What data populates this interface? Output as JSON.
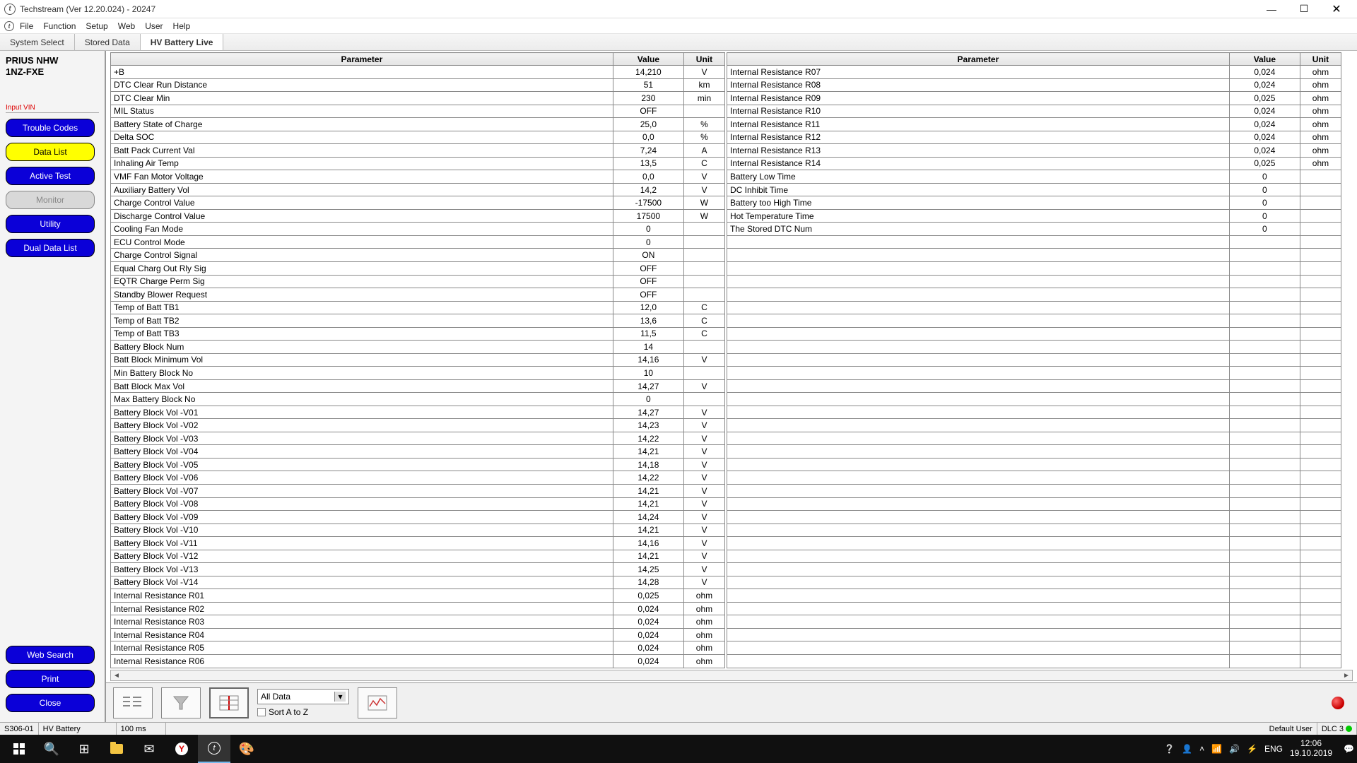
{
  "window": {
    "title": "Techstream (Ver 12.20.024) - 20247"
  },
  "menu": {
    "items": [
      "File",
      "Function",
      "Setup",
      "Web",
      "User",
      "Help"
    ]
  },
  "tabs": [
    {
      "label": "System Select",
      "active": false
    },
    {
      "label": "Stored Data",
      "active": false
    },
    {
      "label": "HV Battery Live",
      "active": true
    }
  ],
  "vehicle": {
    "line1": "PRIUS NHW",
    "line2": "1NZ-FXE",
    "input_vin": "Input VIN"
  },
  "side_buttons": [
    {
      "label": "Trouble Codes",
      "style": "blue"
    },
    {
      "label": "Data List",
      "style": "yellow"
    },
    {
      "label": "Active Test",
      "style": "blue"
    },
    {
      "label": "Monitor",
      "style": "grey"
    },
    {
      "label": "Utility",
      "style": "blue"
    },
    {
      "label": "Dual Data List",
      "style": "blue"
    }
  ],
  "side_bottom_buttons": [
    {
      "label": "Web Search",
      "style": "blue"
    },
    {
      "label": "Print",
      "style": "blue"
    },
    {
      "label": "Close",
      "style": "blue"
    }
  ],
  "table_headers": {
    "parameter": "Parameter",
    "value": "Value",
    "unit": "Unit"
  },
  "left_table": [
    {
      "p": "+B",
      "v": "14,210",
      "u": "V"
    },
    {
      "p": "DTC Clear Run Distance",
      "v": "51",
      "u": "km"
    },
    {
      "p": "DTC Clear Min",
      "v": "230",
      "u": "min"
    },
    {
      "p": "MIL Status",
      "v": "OFF",
      "u": ""
    },
    {
      "p": "Battery State of Charge",
      "v": "25,0",
      "u": "%"
    },
    {
      "p": "Delta SOC",
      "v": "0,0",
      "u": "%"
    },
    {
      "p": "Batt Pack Current Val",
      "v": "7,24",
      "u": "A"
    },
    {
      "p": "Inhaling Air Temp",
      "v": "13,5",
      "u": "C"
    },
    {
      "p": "VMF Fan Motor Voltage",
      "v": "0,0",
      "u": "V"
    },
    {
      "p": "Auxiliary Battery Vol",
      "v": "14,2",
      "u": "V"
    },
    {
      "p": "Charge Control Value",
      "v": "-17500",
      "u": "W"
    },
    {
      "p": "Discharge Control Value",
      "v": "17500",
      "u": "W"
    },
    {
      "p": "Cooling Fan Mode",
      "v": "0",
      "u": ""
    },
    {
      "p": "ECU Control Mode",
      "v": "0",
      "u": ""
    },
    {
      "p": "Charge Control Signal",
      "v": "ON",
      "u": ""
    },
    {
      "p": "Equal Charg Out Rly Sig",
      "v": "OFF",
      "u": ""
    },
    {
      "p": "EQTR Charge Perm Sig",
      "v": "OFF",
      "u": ""
    },
    {
      "p": "Standby Blower Request",
      "v": "OFF",
      "u": ""
    },
    {
      "p": "Temp of Batt TB1",
      "v": "12,0",
      "u": "C"
    },
    {
      "p": "Temp of Batt TB2",
      "v": "13,6",
      "u": "C"
    },
    {
      "p": "Temp of Batt TB3",
      "v": "11,5",
      "u": "C"
    },
    {
      "p": "Battery Block Num",
      "v": "14",
      "u": ""
    },
    {
      "p": "Batt Block Minimum Vol",
      "v": "14,16",
      "u": "V"
    },
    {
      "p": "Min Battery Block No",
      "v": "10",
      "u": ""
    },
    {
      "p": "Batt Block Max Vol",
      "v": "14,27",
      "u": "V"
    },
    {
      "p": "Max Battery Block No",
      "v": "0",
      "u": ""
    },
    {
      "p": "Battery Block Vol -V01",
      "v": "14,27",
      "u": "V"
    },
    {
      "p": "Battery Block Vol -V02",
      "v": "14,23",
      "u": "V"
    },
    {
      "p": "Battery Block Vol -V03",
      "v": "14,22",
      "u": "V"
    },
    {
      "p": "Battery Block Vol -V04",
      "v": "14,21",
      "u": "V"
    },
    {
      "p": "Battery Block Vol -V05",
      "v": "14,18",
      "u": "V"
    },
    {
      "p": "Battery Block Vol -V06",
      "v": "14,22",
      "u": "V"
    },
    {
      "p": "Battery Block Vol -V07",
      "v": "14,21",
      "u": "V"
    },
    {
      "p": "Battery Block Vol -V08",
      "v": "14,21",
      "u": "V"
    },
    {
      "p": "Battery Block Vol -V09",
      "v": "14,24",
      "u": "V"
    },
    {
      "p": "Battery Block Vol -V10",
      "v": "14,21",
      "u": "V"
    },
    {
      "p": "Battery Block Vol -V11",
      "v": "14,16",
      "u": "V"
    },
    {
      "p": "Battery Block Vol -V12",
      "v": "14,21",
      "u": "V"
    },
    {
      "p": "Battery Block Vol -V13",
      "v": "14,25",
      "u": "V"
    },
    {
      "p": "Battery Block Vol -V14",
      "v": "14,28",
      "u": "V"
    },
    {
      "p": "Internal Resistance R01",
      "v": "0,025",
      "u": "ohm"
    },
    {
      "p": "Internal Resistance R02",
      "v": "0,024",
      "u": "ohm"
    },
    {
      "p": "Internal Resistance R03",
      "v": "0,024",
      "u": "ohm"
    },
    {
      "p": "Internal Resistance R04",
      "v": "0,024",
      "u": "ohm"
    },
    {
      "p": "Internal Resistance R05",
      "v": "0,024",
      "u": "ohm"
    },
    {
      "p": "Internal Resistance R06",
      "v": "0,024",
      "u": "ohm"
    }
  ],
  "right_table": [
    {
      "p": "Internal Resistance R07",
      "v": "0,024",
      "u": "ohm"
    },
    {
      "p": "Internal Resistance R08",
      "v": "0,024",
      "u": "ohm"
    },
    {
      "p": "Internal Resistance R09",
      "v": "0,025",
      "u": "ohm"
    },
    {
      "p": "Internal Resistance R10",
      "v": "0,024",
      "u": "ohm"
    },
    {
      "p": "Internal Resistance R11",
      "v": "0,024",
      "u": "ohm"
    },
    {
      "p": "Internal Resistance R12",
      "v": "0,024",
      "u": "ohm"
    },
    {
      "p": "Internal Resistance R13",
      "v": "0,024",
      "u": "ohm"
    },
    {
      "p": "Internal Resistance R14",
      "v": "0,025",
      "u": "ohm"
    },
    {
      "p": "Battery Low Time",
      "v": "0",
      "u": ""
    },
    {
      "p": "DC Inhibit Time",
      "v": "0",
      "u": ""
    },
    {
      "p": "Battery too High Time",
      "v": "0",
      "u": ""
    },
    {
      "p": "Hot Temperature Time",
      "v": "0",
      "u": ""
    },
    {
      "p": "The Stored DTC Num",
      "v": "0",
      "u": ""
    }
  ],
  "right_blank_rows": 33,
  "bottom": {
    "dropdown": "All Data",
    "sort_label": "Sort A to Z"
  },
  "status": {
    "left1": "S306-01",
    "left2": "HV Battery",
    "ms": "100 ms",
    "user": "Default User",
    "dlc": "DLC 3"
  },
  "taskbar": {
    "lang": "ENG",
    "time": "12:06",
    "date": "19.10.2019"
  }
}
